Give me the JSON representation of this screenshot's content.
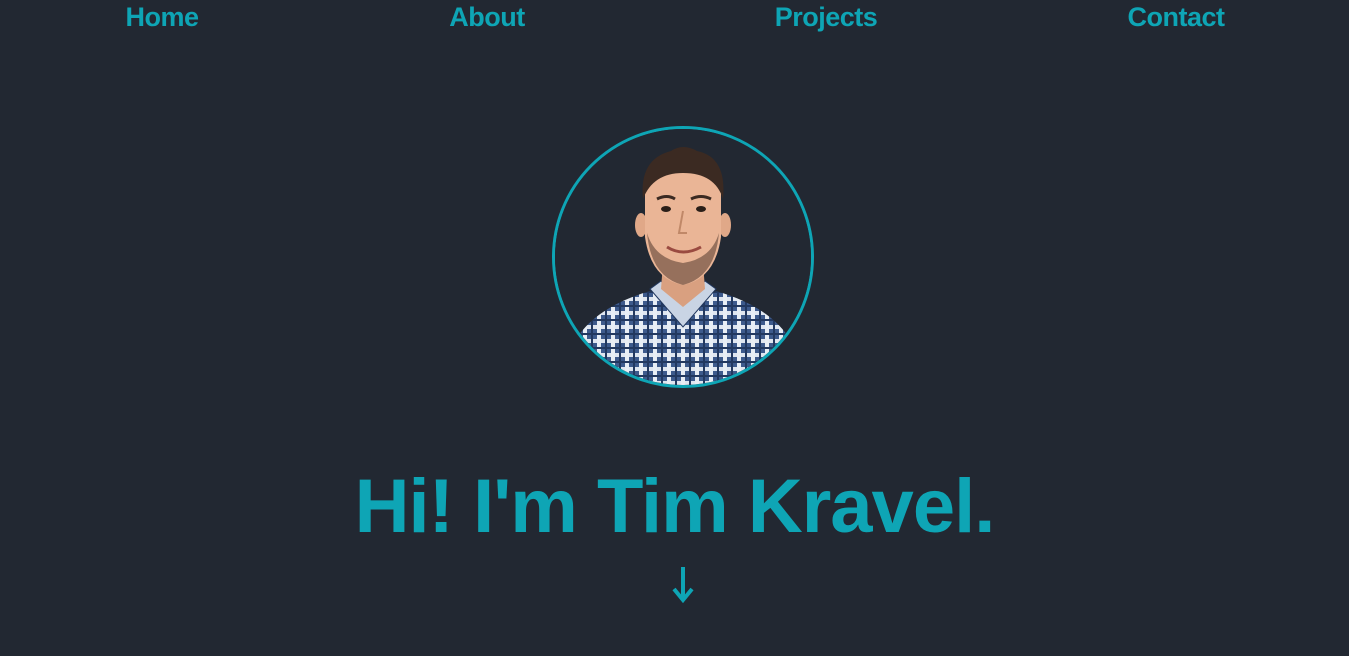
{
  "nav": {
    "items": [
      {
        "label": "Home"
      },
      {
        "label": "About"
      },
      {
        "label": "Projects"
      },
      {
        "label": "Contact"
      }
    ]
  },
  "hero": {
    "title": "Hi! I'm Tim Kravel.",
    "scroll_icon": "arrow-down-icon"
  },
  "colors": {
    "background": "#222832",
    "accent": "#0ea5b5"
  }
}
